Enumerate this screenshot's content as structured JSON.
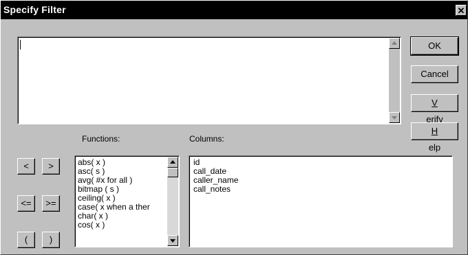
{
  "window": {
    "title": "Specify Filter",
    "close_glyph": "✕"
  },
  "editor": {
    "value": ""
  },
  "buttons": {
    "ok_label": "OK",
    "cancel_label": "Cancel",
    "verify_label": "Verify",
    "verify_mnemonic": "V",
    "verify_rest": "erify",
    "help_label": "Help",
    "help_mnemonic": "H",
    "help_rest": "elp"
  },
  "operators": {
    "less_than": "<",
    "greater_than": ">",
    "less_equal": "<=",
    "greater_equal": ">=",
    "open_paren": "(",
    "close_paren": ")"
  },
  "functions": {
    "label": "Functions:",
    "items": [
      "abs( x )",
      "asc( s )",
      "avg( #x for all )",
      "bitmap ( s )",
      "ceiling( x )",
      "case( x when a ther",
      "char( x )",
      "cos( x )"
    ]
  },
  "columns": {
    "label": "Columns:",
    "items": [
      "id",
      "call_date",
      "caller_name",
      "call_notes"
    ]
  }
}
